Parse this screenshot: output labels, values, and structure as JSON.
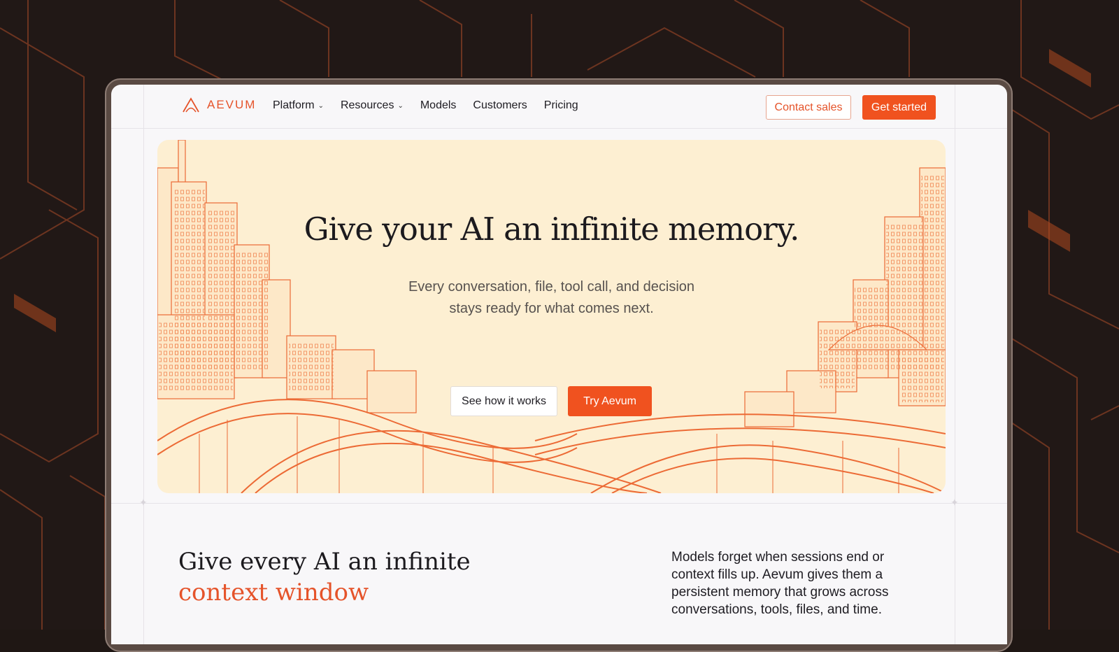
{
  "brand": {
    "name": "AEVUM",
    "logo_icon": "aevum-logo-icon",
    "accent_color": "#f0521f"
  },
  "nav": {
    "items": [
      {
        "label": "Platform",
        "has_dropdown": true
      },
      {
        "label": "Resources",
        "has_dropdown": true
      },
      {
        "label": "Models",
        "has_dropdown": false
      },
      {
        "label": "Customers",
        "has_dropdown": false
      },
      {
        "label": "Pricing",
        "has_dropdown": false
      }
    ],
    "dropdown_icon": "⌄",
    "contact_label": "Contact sales",
    "cta_label": "Get started"
  },
  "hero": {
    "title": "Give your AI an infinite memory.",
    "subtitle_line1": "Every conversation, file, tool call, and decision",
    "subtitle_line2": "stays ready for what comes next.",
    "secondary_button": "See how it works",
    "primary_button": "Try Aevum"
  },
  "section": {
    "title_line1": "Give every AI an infinite",
    "title_line2": "context window",
    "body": "Models forget when sessions end or context fills up. Aevum gives them a persistent memory that grows across conversations, tools, files, and time."
  }
}
